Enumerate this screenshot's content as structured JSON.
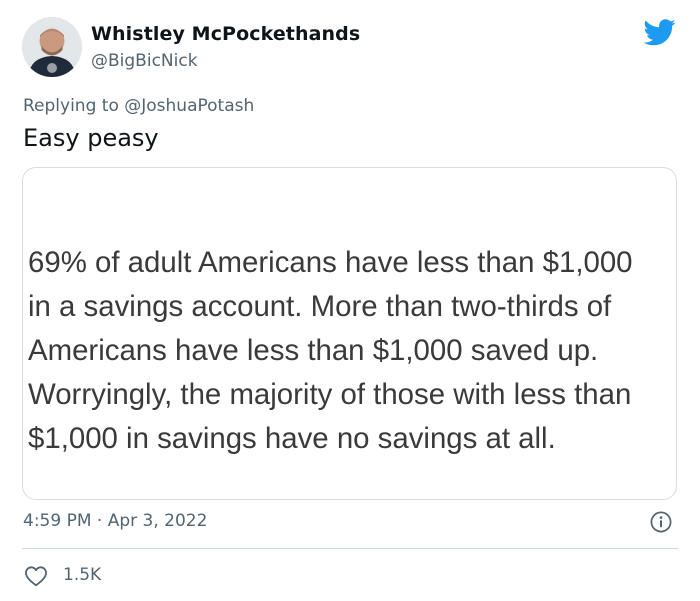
{
  "author": {
    "name": "Whistley McPockethands",
    "handle": "@BigBicNick"
  },
  "reply": {
    "prefix": "Replying to ",
    "handle": "@JoshuaPotash"
  },
  "tweet": {
    "text": "Easy peasy",
    "image_text_lines": [
      "69% of adult Americans have less than $1,000",
      "in a savings account. More than two-thirds of",
      "Americans have less than $1,000 saved up.",
      "Worryingly, the majority of those with less than",
      "$1,000 in savings have no savings at all."
    ],
    "timestamp": "4:59 PM · Apr 3, 2022",
    "likes": "1.5K"
  },
  "icons": {
    "brand": "twitter-bird-icon",
    "info": "info-icon",
    "like": "heart-icon"
  },
  "colors": {
    "brand_blue": "#1d9bf0",
    "text_primary": "#0f1419",
    "text_secondary": "#536471",
    "card_border": "#d6dde2"
  }
}
